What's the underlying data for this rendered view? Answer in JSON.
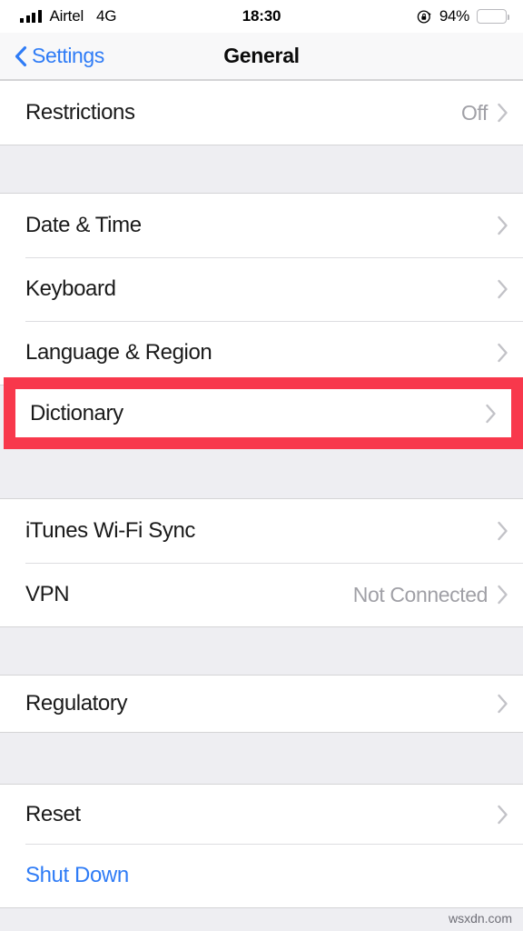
{
  "status_bar": {
    "carrier": "Airtel",
    "network": "4G",
    "time": "18:30",
    "battery_percent": "94%",
    "rotation_lock_icon": "rotation-lock-icon",
    "signal_icon": "signal-bars-icon",
    "battery_icon": "battery-icon"
  },
  "nav_bar": {
    "back_label": "Settings",
    "back_icon": "chevron-left-icon",
    "title": "General"
  },
  "groups": [
    {
      "id": "group-restrictions",
      "rows": [
        {
          "label": "Restrictions",
          "value": "Off",
          "chevron": true,
          "style": "normal"
        }
      ]
    },
    {
      "id": "group-locale",
      "rows": [
        {
          "label": "Date & Time",
          "value": "",
          "chevron": true,
          "style": "normal"
        },
        {
          "label": "Keyboard",
          "value": "",
          "chevron": true,
          "style": "normal"
        },
        {
          "label": "Language & Region",
          "value": "",
          "chevron": true,
          "style": "normal"
        }
      ]
    },
    {
      "id": "group-dictionary",
      "highlighted": true,
      "rows": [
        {
          "label": "Dictionary",
          "value": "",
          "chevron": true,
          "style": "normal"
        }
      ]
    },
    {
      "id": "group-connectivity",
      "rows": [
        {
          "label": "iTunes Wi-Fi Sync",
          "value": "",
          "chevron": true,
          "style": "normal"
        },
        {
          "label": "VPN",
          "value": "Not Connected",
          "chevron": true,
          "style": "normal"
        }
      ]
    },
    {
      "id": "group-regulatory",
      "rows": [
        {
          "label": "Regulatory",
          "value": "",
          "chevron": true,
          "style": "normal"
        }
      ]
    },
    {
      "id": "group-reset",
      "rows": [
        {
          "label": "Reset",
          "value": "",
          "chevron": true,
          "style": "normal"
        },
        {
          "label": "Shut Down",
          "value": "",
          "chevron": false,
          "style": "link"
        }
      ]
    }
  ],
  "highlight": {
    "target_label": "Dictionary",
    "color": "#f8384c"
  },
  "watermark": {
    "text": "wsxdn.com"
  },
  "colors": {
    "accent_blue": "#2f7cf6",
    "background": "#eeeef2",
    "card": "#ffffff",
    "value_gray": "#a0a0a6",
    "separator": "#dddde0",
    "highlight_red": "#f8384c"
  }
}
